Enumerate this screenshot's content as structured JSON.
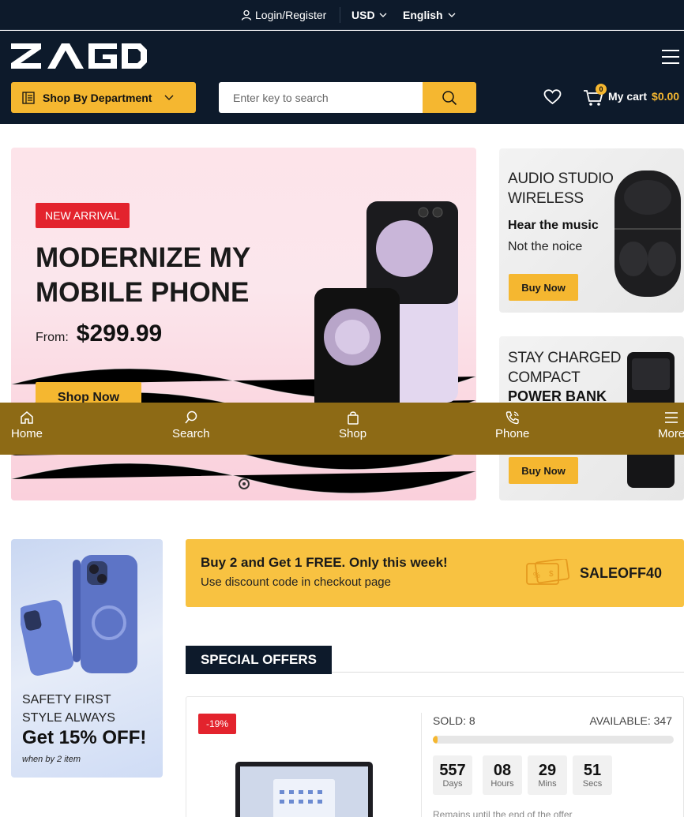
{
  "topbar": {
    "login": "Login/Register",
    "currency": "USD",
    "language": "English"
  },
  "header": {
    "logo": "ZAGD",
    "department_label": "Shop By Department",
    "search_placeholder": "Enter key to search",
    "cart_count": "0",
    "cart_label": "My cart",
    "cart_total": "$0.00"
  },
  "hero": {
    "badge": "NEW ARRIVAL",
    "title": "MODERNIZE MY MOBILE PHONE",
    "from_label": "From:",
    "price": "$299.99",
    "cta": "Shop Now"
  },
  "side_banners": [
    {
      "line1": "AUDIO STUDIO",
      "line2": "WIRELESS",
      "bold": "Hear the music",
      "sub": "Not the noice",
      "cta": "Buy Now"
    },
    {
      "line1": "STAY CHARGED",
      "line2": "COMPACT",
      "bold": "POWER BANK",
      "cta": "Buy Now"
    }
  ],
  "mobile_nav": [
    {
      "label": "Home",
      "icon": "home-icon"
    },
    {
      "label": "Search",
      "icon": "search-icon"
    },
    {
      "label": "Shop",
      "icon": "bag-icon"
    },
    {
      "label": "Phone",
      "icon": "phone-icon"
    },
    {
      "label": "More",
      "icon": "menu-icon"
    }
  ],
  "promo_left": {
    "line1": "SAFETY FIRST",
    "line2": "STYLE ALWAYS",
    "headline": "Get 15% OFF!",
    "note": "when by 2 item"
  },
  "coupon": {
    "title": "Buy 2 and Get 1 FREE. Only this week!",
    "subtitle": "Use discount code in checkout page",
    "code": "SALEOFF40"
  },
  "special_offers": {
    "heading": "SPECIAL OFFERS",
    "discount": "-19%",
    "sold": "SOLD: 8",
    "available": "AVAILABLE: 347",
    "sold_fraction": 0.02,
    "countdown": [
      {
        "value": "557",
        "unit": "Days"
      },
      {
        "value": "08",
        "unit": "Hours"
      },
      {
        "value": "29",
        "unit": "Mins"
      },
      {
        "value": "51",
        "unit": "Secs"
      }
    ],
    "remain_text": "Remains until the end of the offer"
  },
  "colors": {
    "navy": "#0d1a2b",
    "accent": "#f5b730",
    "sale_red": "#e3232d",
    "mobile_nav": "#8d6a15"
  }
}
